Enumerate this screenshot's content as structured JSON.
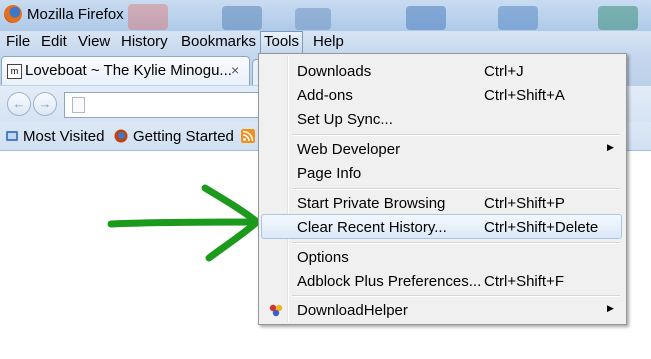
{
  "window": {
    "title": "Mozilla Firefox"
  },
  "menubar": {
    "file": "File",
    "edit": "Edit",
    "view": "View",
    "history": "History",
    "bookmarks": "Bookmarks",
    "tools": "Tools",
    "help": "Help"
  },
  "tab": {
    "title": "Loveboat ~ The Kylie Minogu...",
    "favicon": "m",
    "close": "×"
  },
  "nav": {
    "back": "←",
    "forward": "→"
  },
  "bookmarks_bar": {
    "most_visited": "Most Visited",
    "getting_started": "Getting Started"
  },
  "tools_menu": {
    "downloads": {
      "label": "Downloads",
      "shortcut": "Ctrl+J"
    },
    "addons": {
      "label": "Add-ons",
      "shortcut": "Ctrl+Shift+A"
    },
    "setup_sync": {
      "label": "Set Up Sync..."
    },
    "web_developer": {
      "label": "Web Developer",
      "submenu": "▶"
    },
    "page_info": {
      "label": "Page Info"
    },
    "private_browsing": {
      "label": "Start Private Browsing",
      "shortcut": "Ctrl+Shift+P"
    },
    "clear_history": {
      "label": "Clear Recent History...",
      "shortcut": "Ctrl+Shift+Delete"
    },
    "options": {
      "label": "Options"
    },
    "adblock": {
      "label": "Adblock Plus Preferences...",
      "shortcut": "Ctrl+Shift+F"
    },
    "downloadhelper": {
      "label": "DownloadHelper",
      "submenu": "▶"
    }
  },
  "colors": {
    "highlight_border": "#a8c5e9",
    "arrow": "#1c9a1c",
    "menubar_bg": "#c7d9ee"
  },
  "icons": {
    "window": "firefox-logo-icon",
    "bookmark_most_visited": "bookmark-folder-icon",
    "bookmark_getting_started": "firefox-icon",
    "bookmark_feed": "rss-icon",
    "downloadhelper": "downloadhelper-icon"
  }
}
